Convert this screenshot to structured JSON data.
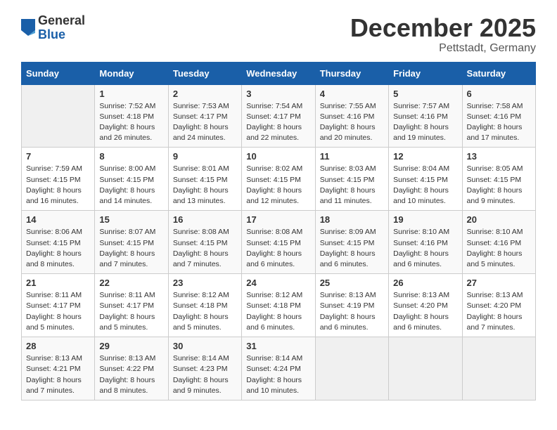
{
  "header": {
    "logo_general": "General",
    "logo_blue": "Blue",
    "month_title": "December 2025",
    "location": "Pettstadt, Germany"
  },
  "calendar": {
    "days_of_week": [
      "Sunday",
      "Monday",
      "Tuesday",
      "Wednesday",
      "Thursday",
      "Friday",
      "Saturday"
    ],
    "weeks": [
      [
        {
          "day": "",
          "info": ""
        },
        {
          "day": "1",
          "info": "Sunrise: 7:52 AM\nSunset: 4:18 PM\nDaylight: 8 hours\nand 26 minutes."
        },
        {
          "day": "2",
          "info": "Sunrise: 7:53 AM\nSunset: 4:17 PM\nDaylight: 8 hours\nand 24 minutes."
        },
        {
          "day": "3",
          "info": "Sunrise: 7:54 AM\nSunset: 4:17 PM\nDaylight: 8 hours\nand 22 minutes."
        },
        {
          "day": "4",
          "info": "Sunrise: 7:55 AM\nSunset: 4:16 PM\nDaylight: 8 hours\nand 20 minutes."
        },
        {
          "day": "5",
          "info": "Sunrise: 7:57 AM\nSunset: 4:16 PM\nDaylight: 8 hours\nand 19 minutes."
        },
        {
          "day": "6",
          "info": "Sunrise: 7:58 AM\nSunset: 4:16 PM\nDaylight: 8 hours\nand 17 minutes."
        }
      ],
      [
        {
          "day": "7",
          "info": "Sunrise: 7:59 AM\nSunset: 4:15 PM\nDaylight: 8 hours\nand 16 minutes."
        },
        {
          "day": "8",
          "info": "Sunrise: 8:00 AM\nSunset: 4:15 PM\nDaylight: 8 hours\nand 14 minutes."
        },
        {
          "day": "9",
          "info": "Sunrise: 8:01 AM\nSunset: 4:15 PM\nDaylight: 8 hours\nand 13 minutes."
        },
        {
          "day": "10",
          "info": "Sunrise: 8:02 AM\nSunset: 4:15 PM\nDaylight: 8 hours\nand 12 minutes."
        },
        {
          "day": "11",
          "info": "Sunrise: 8:03 AM\nSunset: 4:15 PM\nDaylight: 8 hours\nand 11 minutes."
        },
        {
          "day": "12",
          "info": "Sunrise: 8:04 AM\nSunset: 4:15 PM\nDaylight: 8 hours\nand 10 minutes."
        },
        {
          "day": "13",
          "info": "Sunrise: 8:05 AM\nSunset: 4:15 PM\nDaylight: 8 hours\nand 9 minutes."
        }
      ],
      [
        {
          "day": "14",
          "info": "Sunrise: 8:06 AM\nSunset: 4:15 PM\nDaylight: 8 hours\nand 8 minutes."
        },
        {
          "day": "15",
          "info": "Sunrise: 8:07 AM\nSunset: 4:15 PM\nDaylight: 8 hours\nand 7 minutes."
        },
        {
          "day": "16",
          "info": "Sunrise: 8:08 AM\nSunset: 4:15 PM\nDaylight: 8 hours\nand 7 minutes."
        },
        {
          "day": "17",
          "info": "Sunrise: 8:08 AM\nSunset: 4:15 PM\nDaylight: 8 hours\nand 6 minutes."
        },
        {
          "day": "18",
          "info": "Sunrise: 8:09 AM\nSunset: 4:15 PM\nDaylight: 8 hours\nand 6 minutes."
        },
        {
          "day": "19",
          "info": "Sunrise: 8:10 AM\nSunset: 4:16 PM\nDaylight: 8 hours\nand 6 minutes."
        },
        {
          "day": "20",
          "info": "Sunrise: 8:10 AM\nSunset: 4:16 PM\nDaylight: 8 hours\nand 5 minutes."
        }
      ],
      [
        {
          "day": "21",
          "info": "Sunrise: 8:11 AM\nSunset: 4:17 PM\nDaylight: 8 hours\nand 5 minutes."
        },
        {
          "day": "22",
          "info": "Sunrise: 8:11 AM\nSunset: 4:17 PM\nDaylight: 8 hours\nand 5 minutes."
        },
        {
          "day": "23",
          "info": "Sunrise: 8:12 AM\nSunset: 4:18 PM\nDaylight: 8 hours\nand 5 minutes."
        },
        {
          "day": "24",
          "info": "Sunrise: 8:12 AM\nSunset: 4:18 PM\nDaylight: 8 hours\nand 6 minutes."
        },
        {
          "day": "25",
          "info": "Sunrise: 8:13 AM\nSunset: 4:19 PM\nDaylight: 8 hours\nand 6 minutes."
        },
        {
          "day": "26",
          "info": "Sunrise: 8:13 AM\nSunset: 4:20 PM\nDaylight: 8 hours\nand 6 minutes."
        },
        {
          "day": "27",
          "info": "Sunrise: 8:13 AM\nSunset: 4:20 PM\nDaylight: 8 hours\nand 7 minutes."
        }
      ],
      [
        {
          "day": "28",
          "info": "Sunrise: 8:13 AM\nSunset: 4:21 PM\nDaylight: 8 hours\nand 7 minutes."
        },
        {
          "day": "29",
          "info": "Sunrise: 8:13 AM\nSunset: 4:22 PM\nDaylight: 8 hours\nand 8 minutes."
        },
        {
          "day": "30",
          "info": "Sunrise: 8:14 AM\nSunset: 4:23 PM\nDaylight: 8 hours\nand 9 minutes."
        },
        {
          "day": "31",
          "info": "Sunrise: 8:14 AM\nSunset: 4:24 PM\nDaylight: 8 hours\nand 10 minutes."
        },
        {
          "day": "",
          "info": ""
        },
        {
          "day": "",
          "info": ""
        },
        {
          "day": "",
          "info": ""
        }
      ]
    ]
  }
}
